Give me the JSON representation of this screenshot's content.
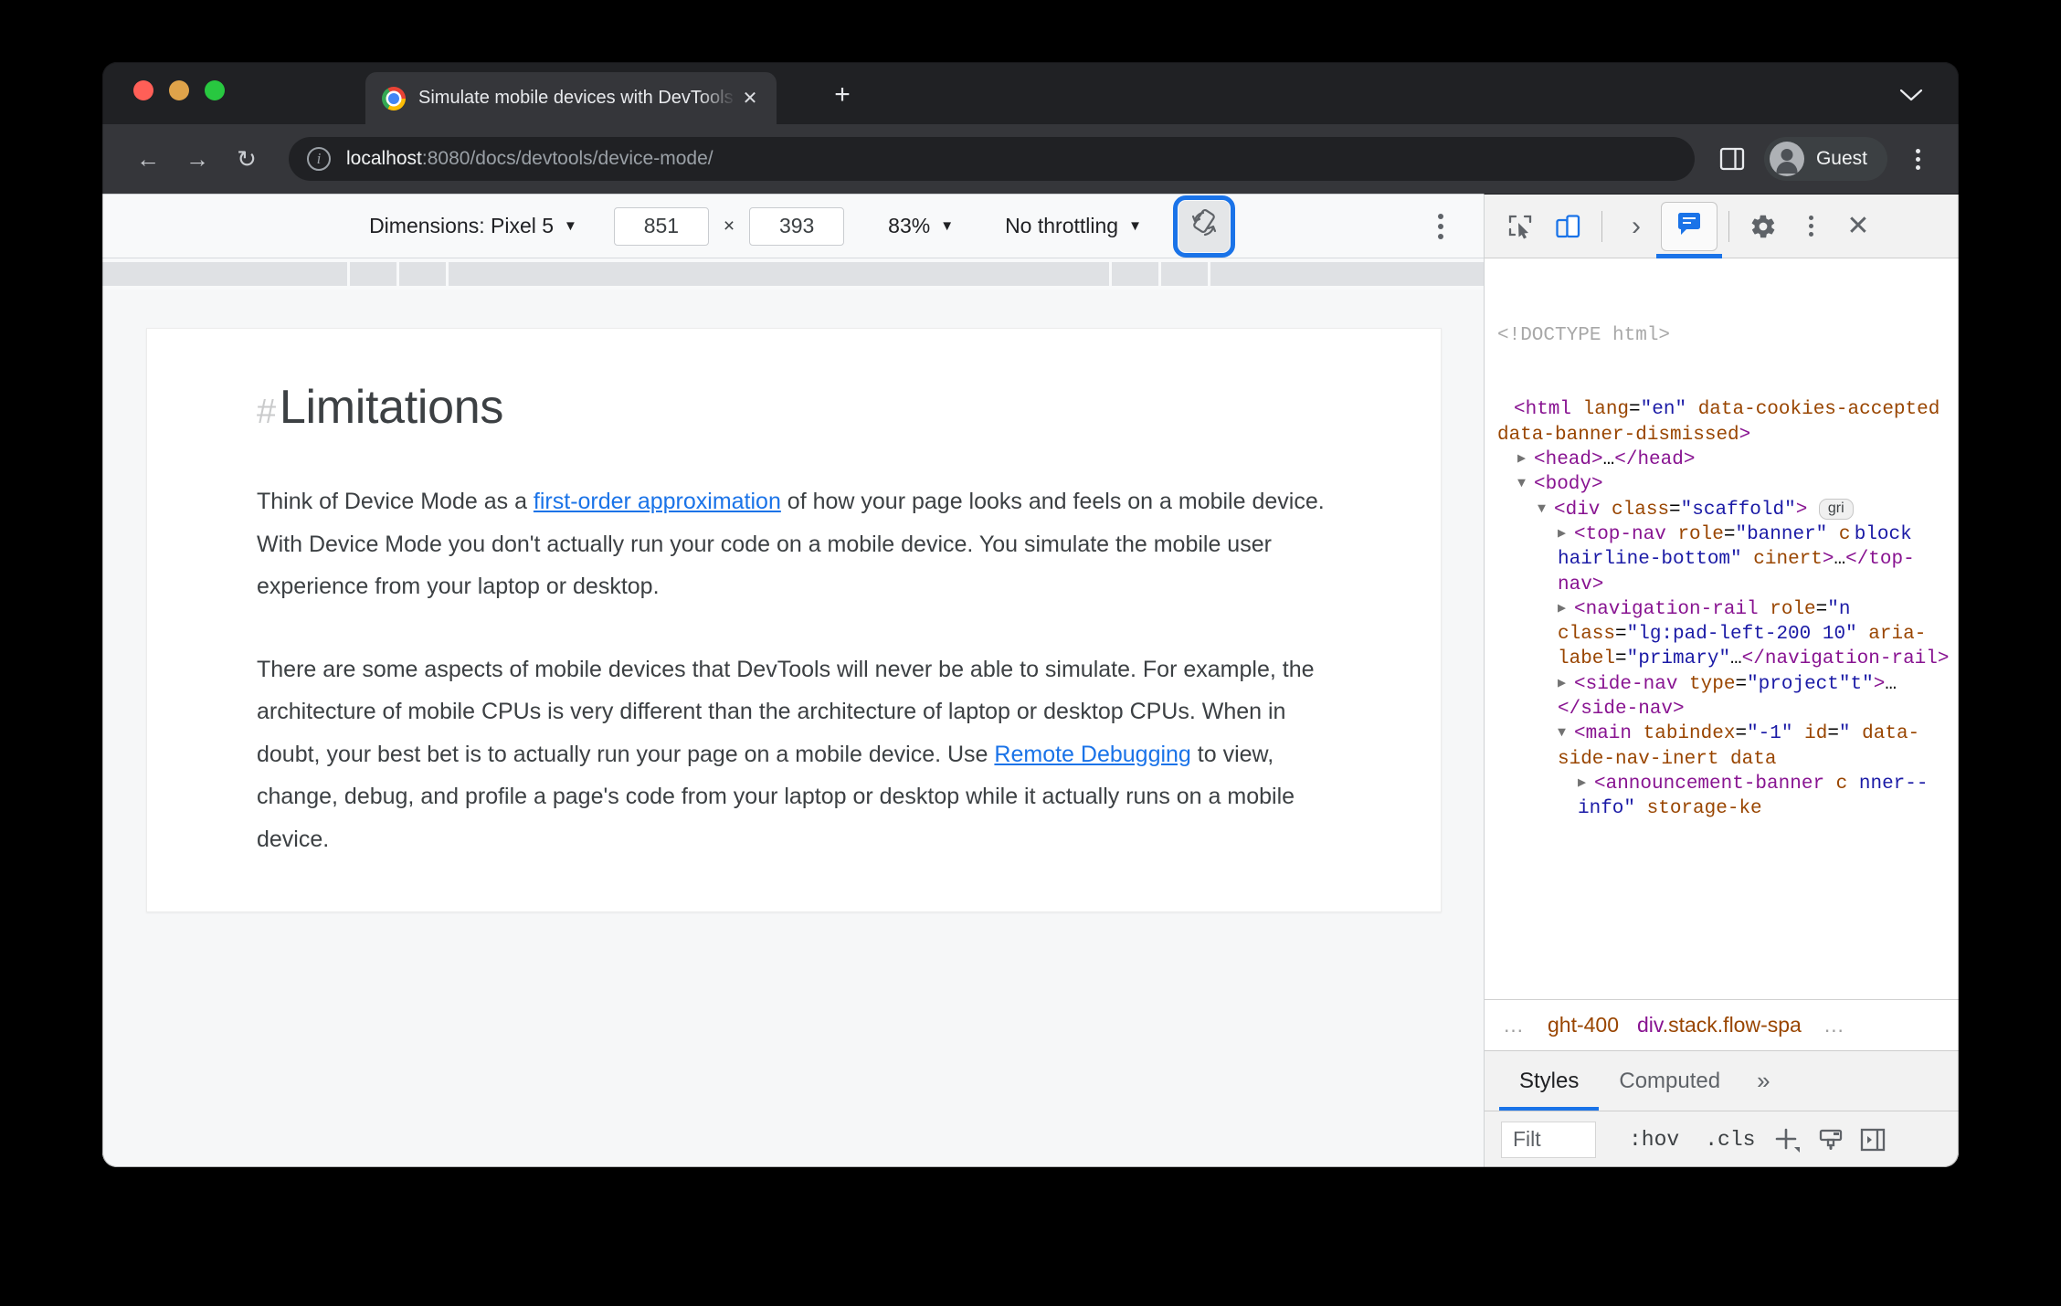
{
  "browser": {
    "tab": {
      "title": "Simulate mobile devices with DevTools",
      "close_label": "✕",
      "favicon_icon": "chrome-favicon"
    },
    "new_tab_label": "+",
    "tabstrip_chevron_icon": "chevron-down-icon",
    "nav": {
      "back_icon": "←",
      "forward_icon": "→",
      "reload_icon": "↻"
    },
    "omnibox": {
      "info_icon": "i",
      "url_host": "localhost",
      "url_rest": ":8080/docs/devtools/device-mode/"
    },
    "side_panel_icon": "side-panel-icon",
    "profile": {
      "label": "Guest",
      "avatar_icon": "person-avatar-icon"
    },
    "menu_icon": "three-dot-menu-icon"
  },
  "device_toolbar": {
    "dimensions_label": "Dimensions: Pixel 5",
    "dimensions_caret": "▼",
    "width_value": "851",
    "multiply": "×",
    "height_value": "393",
    "zoom_value": "83%",
    "zoom_caret": "▼",
    "throttling_value": "No throttling",
    "throttling_caret": "▼",
    "rotate_icon": "rotate-device-icon",
    "more_options_icon": "three-dot-menu-icon"
  },
  "page": {
    "heading_hash": "#",
    "heading": "Limitations",
    "paragraphs": [
      {
        "before": "Think of Device Mode as a ",
        "link": "first-order approximation",
        "after": " of how your page looks and feels on a mobile device. With Device Mode you don't actually run your code on a mobile device. You simulate the mobile user experience from your laptop or desktop."
      },
      {
        "before": "There are some aspects of mobile devices that DevTools will never be able to simulate. For example, the architecture of mobile CPUs is very different than the architecture of laptop or desktop CPUs. When in doubt, your best bet is to actually run your page on a mobile device. Use ",
        "link": "Remote Debugging",
        "after": " to view, change, debug, and profile a page's code from your laptop or desktop while it actually runs on a mobile device."
      }
    ]
  },
  "devtools": {
    "toolbar": {
      "inspect_icon": "inspect-element-icon",
      "device_toggle_icon": "toggle-device-toolbar-icon",
      "overflow_chevron": "›",
      "elements_panel_icon": "elements-panel-icon",
      "settings_icon": "gear-icon",
      "more_icon": "three-dot-menu-icon",
      "close_icon": "✕"
    },
    "dom": {
      "doctype": "<!DOCTYPE html>",
      "lines": [
        {
          "indent": 0,
          "arrow": "",
          "html": "<span class=\"tw\">&lt;html</span> <span class=\"at\">lang</span>=<span class=\"av\">\"en\"</span> <span class=\"at\">data-cookies-accepted</span> <span class=\"at\">data-banner-dismissed</span><span class=\"tw\">&gt;</span>"
        },
        {
          "indent": 1,
          "arrow": "▶",
          "html": "<span class=\"tw\">&lt;head&gt;</span>…<span class=\"tw\">&lt;/head&gt;</span>"
        },
        {
          "indent": 1,
          "arrow": "▼",
          "html": "<span class=\"tw\">&lt;body&gt;</span>"
        },
        {
          "indent": 2,
          "arrow": "▼",
          "html": "<span class=\"tw\">&lt;div</span> <span class=\"at\">class</span>=<span class=\"av\">\"scaffold\"</span><span class=\"tw\">&gt;</span> <span class=\"badge\">gri</span>"
        },
        {
          "indent": 3,
          "arrow": "▶",
          "html": "<span class=\"tw\">&lt;top-nav</span> <span class=\"at\">role</span>=<span class=\"av\">\"banner\"</span> <span class=\"at\">c</span> <span class=\"av\">block hairline-bottom\"</span> <span class=\"at\">c</span><span class=\"at\">inert</span><span class=\"tw\">&gt;</span>…<span class=\"tw\">&lt;/top-nav&gt;</span>"
        },
        {
          "indent": 3,
          "arrow": "▶",
          "html": "<span class=\"tw\">&lt;navigation-rail</span> <span class=\"at\">role</span>=<span class=\"av\">\"n</span> <span class=\"at\">class</span>=<span class=\"av\">\"lg:pad-left-200 1</span><span class=\"av\">0\"</span> <span class=\"at\">aria-label</span>=<span class=\"av\">\"primary\"</span>…<span class=\"tw\">&lt;/navigation-rail&gt;</span>"
        },
        {
          "indent": 3,
          "arrow": "▶",
          "html": "<span class=\"tw\">&lt;side-nav</span> <span class=\"at\">type</span>=<span class=\"av\">\"project\"</span><span class=\"av\">t\"</span><span class=\"tw\">&gt;</span>…<span class=\"tw\">&lt;/side-nav&gt;</span>"
        },
        {
          "indent": 3,
          "arrow": "▼",
          "html": "<span class=\"tw\">&lt;main</span> <span class=\"at\">tabindex</span>=<span class=\"av\">\"-1\"</span> <span class=\"at\">id</span>=<span class=\"av\">\"</span> <span class=\"at\">data-side-nav-inert</span> <span class=\"at\">data</span>"
        },
        {
          "indent": 4,
          "arrow": "▶",
          "html": "<span class=\"tw\">&lt;announcement-banner</span> <span class=\"at\">c</span> <span class=\"av\">nner--info\"</span> <span class=\"at\">storage-ke</span>"
        }
      ]
    },
    "breadcrumb": {
      "left_ellipsis": "…",
      "items": [
        "ght-400",
        "div.stack.flow-spa"
      ],
      "right_ellipsis": "…"
    },
    "styles_tabs": {
      "styles": "Styles",
      "computed": "Computed",
      "more": "»"
    },
    "styles_toolbar": {
      "filter_value": "Filt",
      "hov": ":hov",
      "cls": ".cls",
      "add_rule_icon": "plus-icon",
      "computed_styles_icon": "paintbrush-icon",
      "sidebar_toggle_icon": "toggle-sidebar-icon"
    }
  },
  "colors": {
    "accent_blue": "#1a73e8",
    "link_blue": "#1a73e8",
    "chrome_dark": "#202124",
    "tag_purple": "#881391",
    "attr_orange": "#994500",
    "value_blue": "#1a1aa6"
  }
}
